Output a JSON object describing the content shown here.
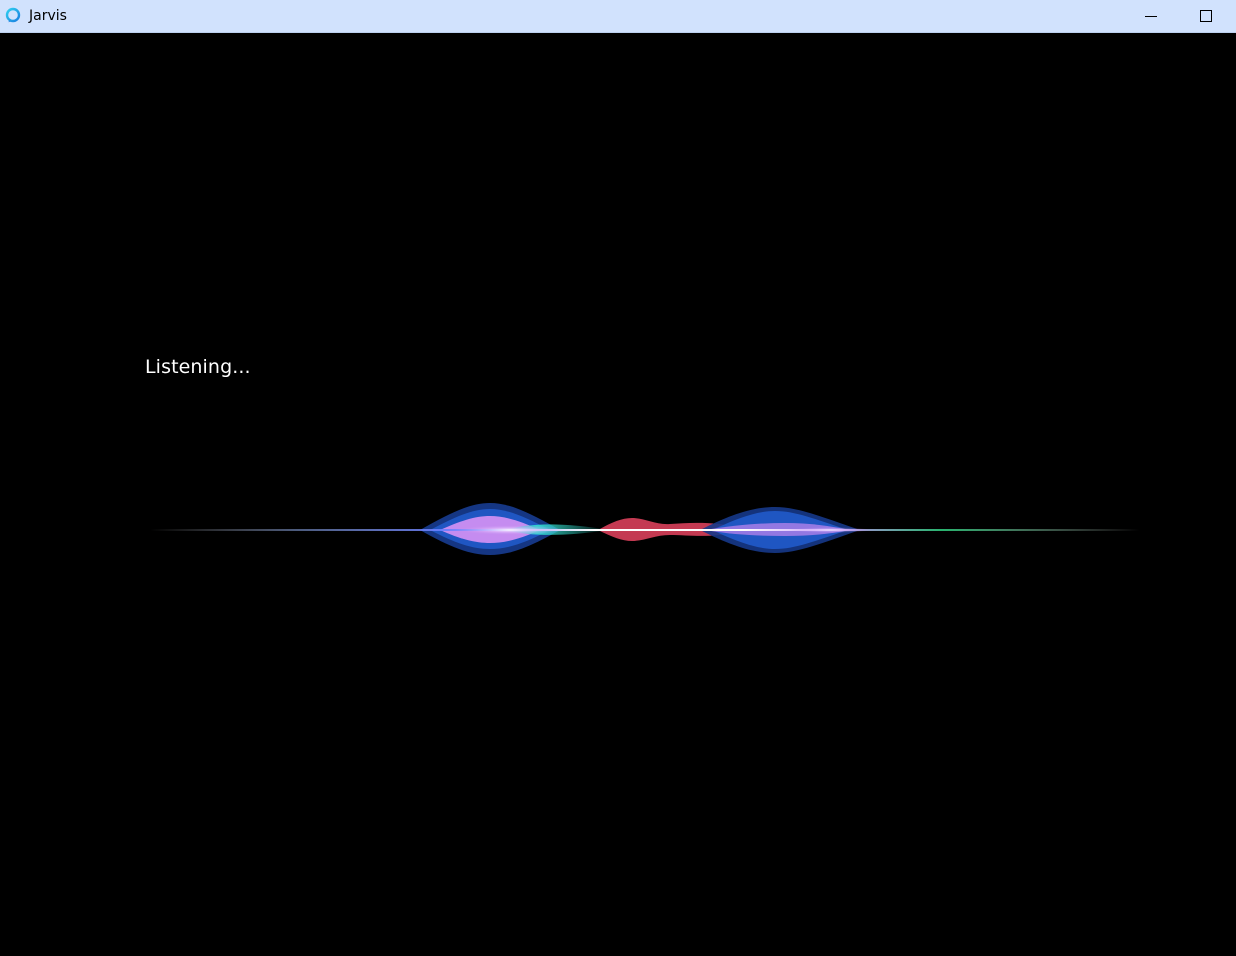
{
  "window": {
    "title": "Jarvis",
    "icon": "jarvis-ring-icon",
    "controls": {
      "minimize_icon": "minimize-icon",
      "maximize_icon": "maximize-icon"
    }
  },
  "main": {
    "status_text": "Listening...",
    "visualizer": "voice-waveform"
  },
  "colors": {
    "titlebar_bg": "#d1e2fd",
    "content_bg": "#000000",
    "wave_blue": "#1a4fb0",
    "wave_purple": "#c58cf0",
    "wave_cyan": "#33e0d0",
    "wave_red": "#d23a55"
  }
}
